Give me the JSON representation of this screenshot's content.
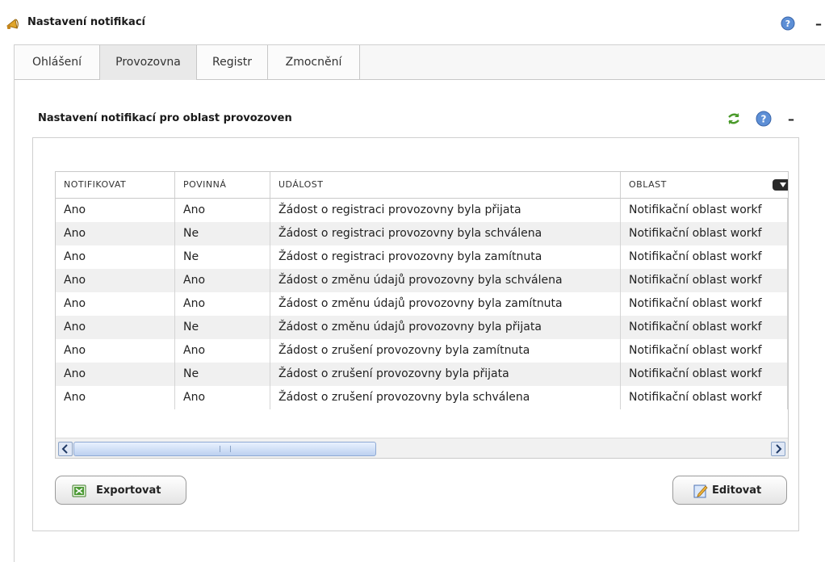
{
  "header": {
    "title": "Nastavení notifikací",
    "app_icon": "megaphone-icon",
    "help_icon": "help-icon",
    "minimize_label": "–"
  },
  "tabs": [
    {
      "label": "Ohlášení",
      "active": false
    },
    {
      "label": "Provozovna",
      "active": true
    },
    {
      "label": "Registr",
      "active": false
    },
    {
      "label": "Zmocnění",
      "active": false
    }
  ],
  "section": {
    "title": "Nastavení notifikací pro oblast provozoven",
    "minimize_label": "–"
  },
  "table": {
    "columns": [
      "NOTIFIKOVAT",
      "POVINNÁ",
      "UDÁLOST",
      "OBLAST"
    ],
    "rows": [
      [
        "Ano",
        "Ano",
        "Žádost o registraci provozovny byla přijata",
        "Notifikační oblast workf"
      ],
      [
        "Ano",
        "Ne",
        "Žádost o registraci provozovny byla schválena",
        "Notifikační oblast workf"
      ],
      [
        "Ano",
        "Ne",
        "Žádost o registraci provozovny byla zamítnuta",
        "Notifikační oblast workf"
      ],
      [
        "Ano",
        "Ano",
        "Žádost o změnu údajů provozovny byla schválena",
        "Notifikační oblast workf"
      ],
      [
        "Ano",
        "Ano",
        "Žádost o změnu údajů provozovny byla zamítnuta",
        "Notifikační oblast workf"
      ],
      [
        "Ano",
        "Ne",
        "Žádost o změnu údajů provozovny byla přijata",
        "Notifikační oblast workf"
      ],
      [
        "Ano",
        "Ano",
        "Žádost o zrušení provozovny byla zamítnuta",
        "Notifikační oblast workf"
      ],
      [
        "Ano",
        "Ne",
        "Žádost o zrušení provozovny byla přijata",
        "Notifikační oblast workf"
      ],
      [
        "Ano",
        "Ano",
        "Žádost o zrušení provozovny byla schválena",
        "Notifikační oblast workf"
      ]
    ]
  },
  "buttons": {
    "export_label": "Exportovat",
    "edit_label": "Editovat"
  },
  "colors": {
    "row_alt": "#f0f0f0",
    "border": "#c9c9c9",
    "scroll_thumb": "#bcd0f0"
  }
}
